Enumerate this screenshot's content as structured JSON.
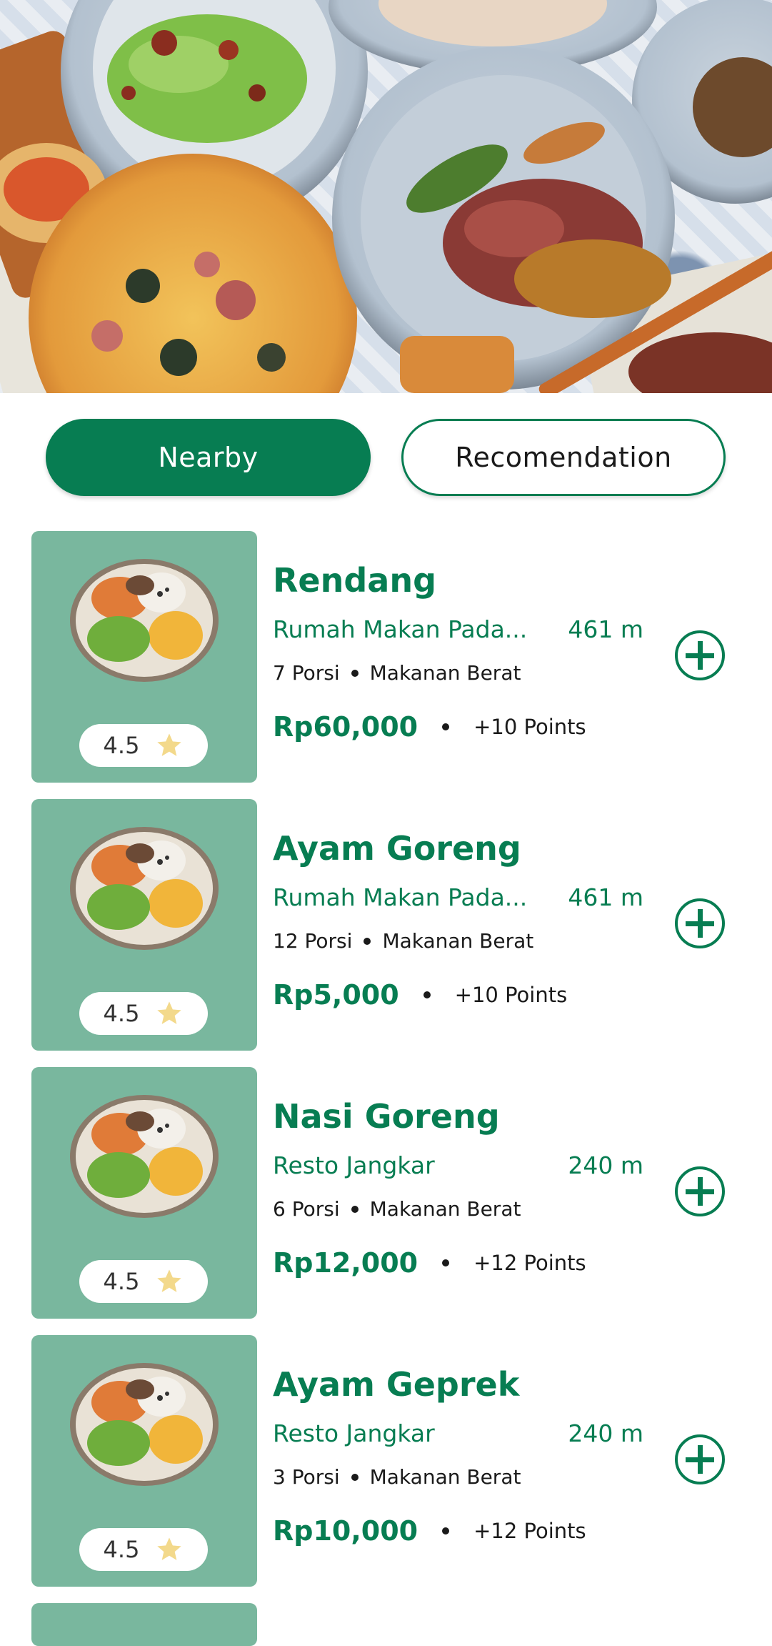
{
  "tabs": {
    "nearby": "Nearby",
    "recommendation": "Recomendation"
  },
  "colors": {
    "brand": "#077d52",
    "thumb_bg": "#79b79e",
    "star": "#f3d98b"
  },
  "icons": {
    "add": "plus-circle-icon",
    "rating": "star-icon"
  },
  "items": [
    {
      "name": "Rendang",
      "resto": "Rumah Makan Pada...",
      "distance": "461 m",
      "portion": "7 Porsi",
      "category": "Makanan Berat",
      "price": "Rp60,000",
      "points": "+10 Points",
      "rating": "4.5"
    },
    {
      "name": "Ayam Goreng",
      "resto": "Rumah Makan Pada...",
      "distance": "461 m",
      "portion": "12 Porsi",
      "category": "Makanan Berat",
      "price": "Rp5,000",
      "points": "+10 Points",
      "rating": "4.5"
    },
    {
      "name": "Nasi Goreng",
      "resto": "Resto Jangkar",
      "distance": "240 m",
      "portion": "6 Porsi",
      "category": "Makanan Berat",
      "price": "Rp12,000",
      "points": "+12 Points",
      "rating": "4.5"
    },
    {
      "name": "Ayam Geprek",
      "resto": "Resto Jangkar",
      "distance": "240 m",
      "portion": "3 Porsi",
      "category": "Makanan Berat",
      "price": "Rp10,000",
      "points": "+12 Points",
      "rating": "4.5"
    }
  ]
}
